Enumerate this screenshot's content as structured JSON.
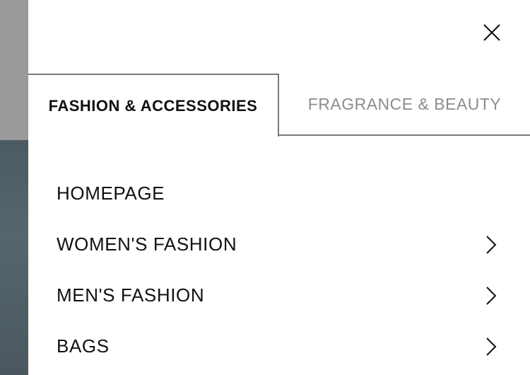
{
  "drawer": {
    "close_icon": "close-icon",
    "tabs": [
      {
        "label": "FASHION & ACCESSORIES",
        "active": true
      },
      {
        "label": "FRAGRANCE & BEAUTY",
        "active": false
      }
    ],
    "menu": [
      {
        "label": "HOMEPAGE",
        "has_submenu": false
      },
      {
        "label": "WOMEN'S FASHION",
        "has_submenu": true,
        "icon": "chevron-right-icon"
      },
      {
        "label": "MEN'S FASHION",
        "has_submenu": true,
        "icon": "chevron-right-icon"
      },
      {
        "label": "BAGS",
        "has_submenu": true,
        "icon": "chevron-right-icon"
      }
    ]
  },
  "colors": {
    "text_primary": "#111111",
    "text_inactive": "#8c8c8c",
    "border": "#7a7a7a",
    "backdrop_gray": "#9a9a9a",
    "backdrop_dark": "#4c5a63"
  }
}
